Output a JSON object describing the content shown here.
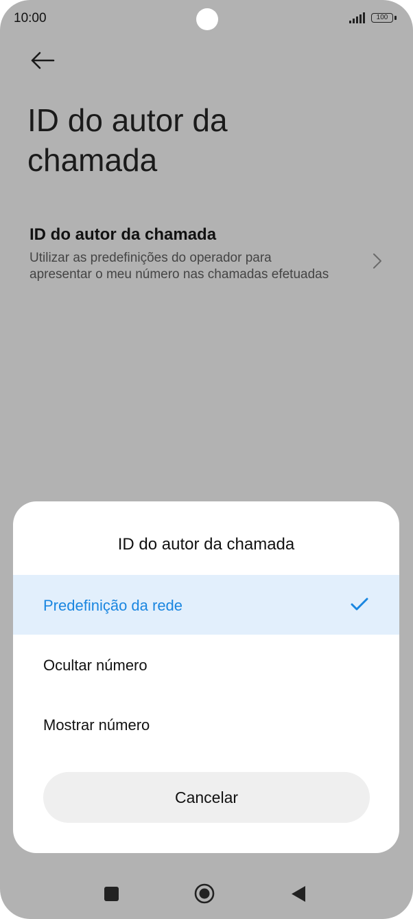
{
  "status_bar": {
    "time": "10:00",
    "battery": "100"
  },
  "header": {
    "title": "ID do autor da chamada"
  },
  "setting": {
    "title": "ID do autor da chamada",
    "subtitle": "Utilizar as predefinições do operador para apresentar o meu número nas chamadas efetuadas"
  },
  "dialog": {
    "title": "ID do autor da chamada",
    "options": [
      {
        "label": "Predefinição da rede",
        "selected": true
      },
      {
        "label": "Ocultar número",
        "selected": false
      },
      {
        "label": "Mostrar número",
        "selected": false
      }
    ],
    "cancel_label": "Cancelar"
  },
  "colors": {
    "accent": "#1a86e0",
    "selected_bg": "#e2effc",
    "scrim": "#b2b2b2"
  },
  "icons": {
    "back": "arrow-left",
    "chevron": "chevron-right",
    "check": "checkmark",
    "nav_recent": "square",
    "nav_home": "circle",
    "nav_back": "triangle-left"
  }
}
